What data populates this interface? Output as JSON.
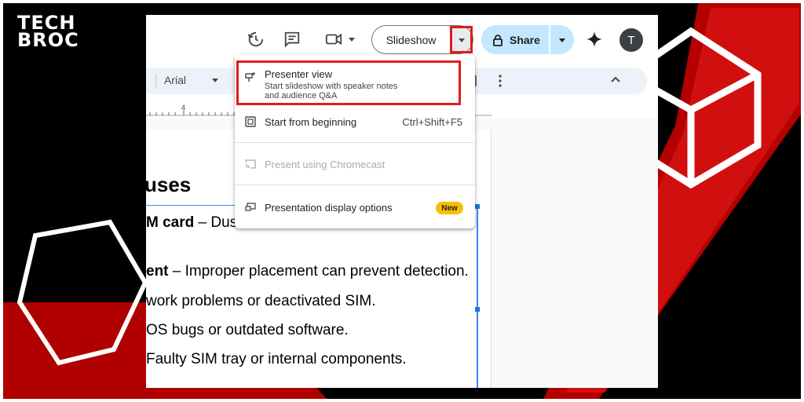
{
  "logo": {
    "line1": "TECH",
    "line2": "BROC"
  },
  "topbar": {
    "slideshow_label": "Slideshow",
    "share_label": "Share",
    "avatar_initial": "T",
    "icons": [
      "history-icon",
      "comment-icon",
      "camera-icon",
      "chevron-down-icon",
      "lock-icon",
      "gemini-icon"
    ]
  },
  "toolbar": {
    "font": "Arial"
  },
  "ruler": {
    "mark": "4"
  },
  "slide": {
    "title": "uses",
    "bullets": [
      {
        "bold": "M card",
        "text": " – Dus"
      },
      {
        "bold": "ent",
        "text": " – Improper placement can prevent detection."
      },
      {
        "bold": "",
        "text": "work problems or deactivated SIM."
      },
      {
        "bold": "",
        "text": "OS bugs or outdated software."
      },
      {
        "bold": "",
        "text": " Faulty SIM tray or internal components."
      }
    ]
  },
  "menu": {
    "presenter_view": {
      "label": "Presenter view",
      "sub1": "Start slideshow with speaker notes",
      "sub2": "and audience Q&A"
    },
    "start_beginning": {
      "label": "Start from beginning",
      "shortcut": "Ctrl+Shift+F5"
    },
    "chromecast": {
      "label": "Present using Chromecast"
    },
    "display_options": {
      "label": "Presentation display options",
      "badge": "New"
    }
  },
  "colors": {
    "highlight": "#e21b1b",
    "share_bg": "#c2e7ff",
    "badge": "#fbbc04",
    "selection": "#4285f4",
    "bg_red": "#c00000"
  }
}
